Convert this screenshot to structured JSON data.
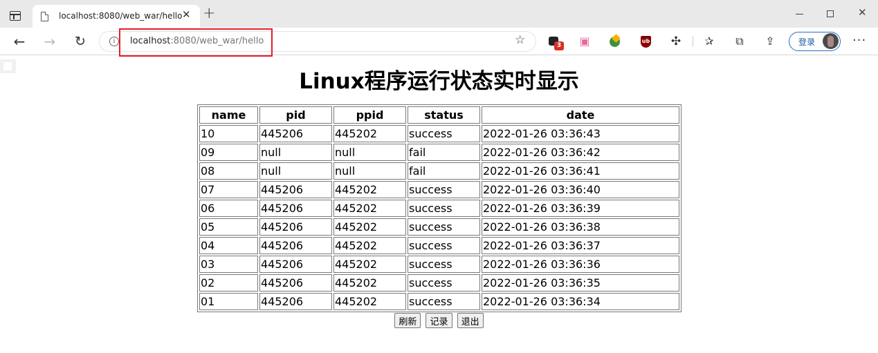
{
  "browser": {
    "tab_title": "localhost:8080/web_war/hello",
    "url_host": "localhost",
    "url_path": ":8080/web_war/hello",
    "login_label": "登录",
    "ext_badge_count": "3",
    "highlight_color": "#e0202a",
    "icons": [
      "tab-actions-icon",
      "page-icon",
      "close-icon",
      "plus-icon",
      "back-icon",
      "forward-icon",
      "reload-icon",
      "info-icon",
      "star-add-icon",
      "puzzle-icon",
      "favorites-icon",
      "collections-icon",
      "share-icon",
      "more-icon"
    ]
  },
  "page": {
    "title": "Linux程序运行状态实时显示",
    "columns": [
      "name",
      "pid",
      "ppid",
      "status",
      "date"
    ],
    "rows": [
      [
        "10",
        "445206",
        "445202",
        "success",
        "2022-01-26 03:36:43"
      ],
      [
        "09",
        "null",
        "null",
        "fail",
        "2022-01-26 03:36:42"
      ],
      [
        "08",
        "null",
        "null",
        "fail",
        "2022-01-26 03:36:41"
      ],
      [
        "07",
        "445206",
        "445202",
        "success",
        "2022-01-26 03:36:40"
      ],
      [
        "06",
        "445206",
        "445202",
        "success",
        "2022-01-26 03:36:39"
      ],
      [
        "05",
        "445206",
        "445202",
        "success",
        "2022-01-26 03:36:38"
      ],
      [
        "04",
        "445206",
        "445202",
        "success",
        "2022-01-26 03:36:37"
      ],
      [
        "03",
        "445206",
        "445202",
        "success",
        "2022-01-26 03:36:36"
      ],
      [
        "02",
        "445206",
        "445202",
        "success",
        "2022-01-26 03:36:35"
      ],
      [
        "01",
        "445206",
        "445202",
        "success",
        "2022-01-26 03:36:34"
      ]
    ],
    "buttons": {
      "refresh": "刷新",
      "records": "记录",
      "exit": "退出"
    }
  }
}
